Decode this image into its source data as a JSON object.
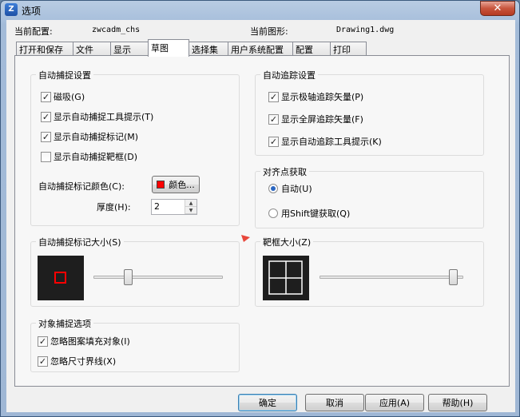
{
  "window": {
    "title": "选项",
    "app_icon": "zwcad-app-icon",
    "close_glyph": "✕"
  },
  "config": {
    "current_profile_label": "当前配置:",
    "current_profile_value": "zwcadm_chs",
    "current_drawing_label": "当前图形:",
    "current_drawing_value": "Drawing1.dwg"
  },
  "tabs": [
    {
      "label": "打开和保存"
    },
    {
      "label": "文件"
    },
    {
      "label": "显示"
    },
    {
      "label": "草图"
    },
    {
      "label": "选择集"
    },
    {
      "label": "用户系统配置"
    },
    {
      "label": "配置"
    },
    {
      "label": "打印"
    }
  ],
  "active_tab": "草图",
  "autosnap": {
    "title": "自动捕捉设置",
    "options": [
      {
        "label": "磁吸(G)",
        "checked": true
      },
      {
        "label": "显示自动捕捉工具提示(T)",
        "checked": true
      },
      {
        "label": "显示自动捕捉标记(M)",
        "checked": true
      },
      {
        "label": "显示自动捕捉靶框(D)",
        "checked": false
      }
    ],
    "marker_color_label": "自动捕捉标记颜色(C):",
    "color_button_label": "颜色...",
    "marker_color": "#ff0000",
    "thickness_label": "厚度(H):",
    "thickness_value": "2"
  },
  "autotrack": {
    "title": "自动追踪设置",
    "options": [
      {
        "label": "显示极轴追踪矢量(P)",
        "checked": true
      },
      {
        "label": "显示全屏追踪矢量(F)",
        "checked": true
      },
      {
        "label": "显示自动追踪工具提示(K)",
        "checked": true
      }
    ]
  },
  "alignment": {
    "title": "对齐点获取",
    "options": [
      {
        "label": "自动(U)",
        "selected": true
      },
      {
        "label": "用Shift键获取(Q)",
        "selected": false
      }
    ]
  },
  "marker_size": {
    "title": "自动捕捉标记大小(S)",
    "level": 0.25
  },
  "aperture_size": {
    "title": "靶框大小(Z)",
    "level": 0.96
  },
  "object_snap": {
    "title": "对象捕捉选项",
    "options": [
      {
        "label": "忽略图案填充对象(I)",
        "checked": true
      },
      {
        "label": "忽略尺寸界线(X)",
        "checked": true
      }
    ]
  },
  "buttons": {
    "ok": "确定",
    "cancel": "取消",
    "apply": "应用(A)",
    "help": "帮助(H)"
  },
  "check_glyph": "✓",
  "colors": {
    "accent_arrow": "#e8473b",
    "marker_red": "#ff0000",
    "preview_bg": "#1e1e1e"
  }
}
